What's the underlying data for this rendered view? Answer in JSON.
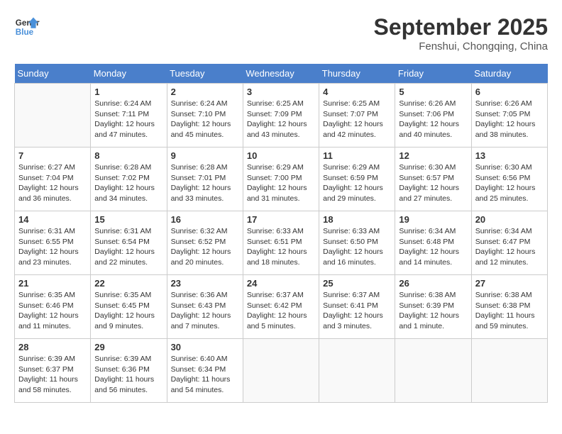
{
  "header": {
    "logo_line1": "General",
    "logo_line2": "Blue",
    "month": "September 2025",
    "location": "Fenshui, Chongqing, China"
  },
  "days_of_week": [
    "Sunday",
    "Monday",
    "Tuesday",
    "Wednesday",
    "Thursday",
    "Friday",
    "Saturday"
  ],
  "weeks": [
    [
      {
        "day": "",
        "info": ""
      },
      {
        "day": "1",
        "info": "Sunrise: 6:24 AM\nSunset: 7:11 PM\nDaylight: 12 hours\nand 47 minutes."
      },
      {
        "day": "2",
        "info": "Sunrise: 6:24 AM\nSunset: 7:10 PM\nDaylight: 12 hours\nand 45 minutes."
      },
      {
        "day": "3",
        "info": "Sunrise: 6:25 AM\nSunset: 7:09 PM\nDaylight: 12 hours\nand 43 minutes."
      },
      {
        "day": "4",
        "info": "Sunrise: 6:25 AM\nSunset: 7:07 PM\nDaylight: 12 hours\nand 42 minutes."
      },
      {
        "day": "5",
        "info": "Sunrise: 6:26 AM\nSunset: 7:06 PM\nDaylight: 12 hours\nand 40 minutes."
      },
      {
        "day": "6",
        "info": "Sunrise: 6:26 AM\nSunset: 7:05 PM\nDaylight: 12 hours\nand 38 minutes."
      }
    ],
    [
      {
        "day": "7",
        "info": "Sunrise: 6:27 AM\nSunset: 7:04 PM\nDaylight: 12 hours\nand 36 minutes."
      },
      {
        "day": "8",
        "info": "Sunrise: 6:28 AM\nSunset: 7:02 PM\nDaylight: 12 hours\nand 34 minutes."
      },
      {
        "day": "9",
        "info": "Sunrise: 6:28 AM\nSunset: 7:01 PM\nDaylight: 12 hours\nand 33 minutes."
      },
      {
        "day": "10",
        "info": "Sunrise: 6:29 AM\nSunset: 7:00 PM\nDaylight: 12 hours\nand 31 minutes."
      },
      {
        "day": "11",
        "info": "Sunrise: 6:29 AM\nSunset: 6:59 PM\nDaylight: 12 hours\nand 29 minutes."
      },
      {
        "day": "12",
        "info": "Sunrise: 6:30 AM\nSunset: 6:57 PM\nDaylight: 12 hours\nand 27 minutes."
      },
      {
        "day": "13",
        "info": "Sunrise: 6:30 AM\nSunset: 6:56 PM\nDaylight: 12 hours\nand 25 minutes."
      }
    ],
    [
      {
        "day": "14",
        "info": "Sunrise: 6:31 AM\nSunset: 6:55 PM\nDaylight: 12 hours\nand 23 minutes."
      },
      {
        "day": "15",
        "info": "Sunrise: 6:31 AM\nSunset: 6:54 PM\nDaylight: 12 hours\nand 22 minutes."
      },
      {
        "day": "16",
        "info": "Sunrise: 6:32 AM\nSunset: 6:52 PM\nDaylight: 12 hours\nand 20 minutes."
      },
      {
        "day": "17",
        "info": "Sunrise: 6:33 AM\nSunset: 6:51 PM\nDaylight: 12 hours\nand 18 minutes."
      },
      {
        "day": "18",
        "info": "Sunrise: 6:33 AM\nSunset: 6:50 PM\nDaylight: 12 hours\nand 16 minutes."
      },
      {
        "day": "19",
        "info": "Sunrise: 6:34 AM\nSunset: 6:48 PM\nDaylight: 12 hours\nand 14 minutes."
      },
      {
        "day": "20",
        "info": "Sunrise: 6:34 AM\nSunset: 6:47 PM\nDaylight: 12 hours\nand 12 minutes."
      }
    ],
    [
      {
        "day": "21",
        "info": "Sunrise: 6:35 AM\nSunset: 6:46 PM\nDaylight: 12 hours\nand 11 minutes."
      },
      {
        "day": "22",
        "info": "Sunrise: 6:35 AM\nSunset: 6:45 PM\nDaylight: 12 hours\nand 9 minutes."
      },
      {
        "day": "23",
        "info": "Sunrise: 6:36 AM\nSunset: 6:43 PM\nDaylight: 12 hours\nand 7 minutes."
      },
      {
        "day": "24",
        "info": "Sunrise: 6:37 AM\nSunset: 6:42 PM\nDaylight: 12 hours\nand 5 minutes."
      },
      {
        "day": "25",
        "info": "Sunrise: 6:37 AM\nSunset: 6:41 PM\nDaylight: 12 hours\nand 3 minutes."
      },
      {
        "day": "26",
        "info": "Sunrise: 6:38 AM\nSunset: 6:39 PM\nDaylight: 12 hours\nand 1 minute."
      },
      {
        "day": "27",
        "info": "Sunrise: 6:38 AM\nSunset: 6:38 PM\nDaylight: 11 hours\nand 59 minutes."
      }
    ],
    [
      {
        "day": "28",
        "info": "Sunrise: 6:39 AM\nSunset: 6:37 PM\nDaylight: 11 hours\nand 58 minutes."
      },
      {
        "day": "29",
        "info": "Sunrise: 6:39 AM\nSunset: 6:36 PM\nDaylight: 11 hours\nand 56 minutes."
      },
      {
        "day": "30",
        "info": "Sunrise: 6:40 AM\nSunset: 6:34 PM\nDaylight: 11 hours\nand 54 minutes."
      },
      {
        "day": "",
        "info": ""
      },
      {
        "day": "",
        "info": ""
      },
      {
        "day": "",
        "info": ""
      },
      {
        "day": "",
        "info": ""
      }
    ]
  ]
}
